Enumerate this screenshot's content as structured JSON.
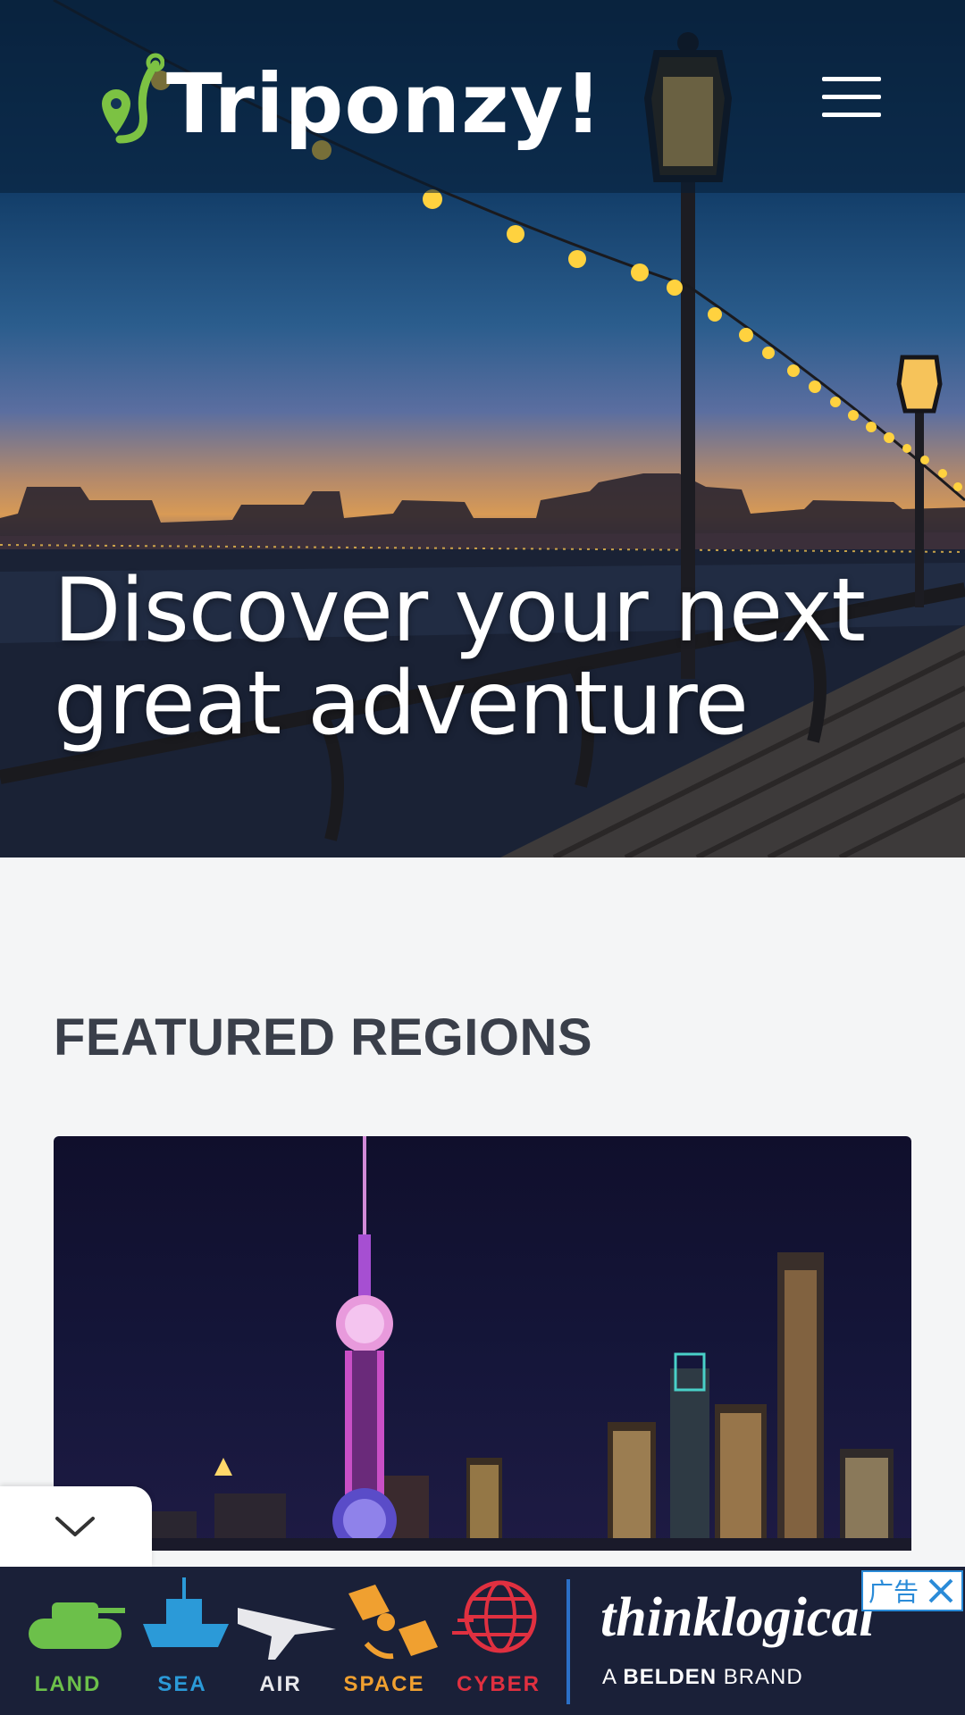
{
  "header": {
    "logo_text": "Triponzy!",
    "logo_icon": "map-pin-route-icon",
    "menu_icon": "hamburger-menu-icon"
  },
  "hero": {
    "title": "Discover your next great adventure"
  },
  "featured": {
    "section_title": "FEATURED REGIONS",
    "card_image": "city-skyline-night-image"
  },
  "collapse": {
    "icon": "chevron-down-icon"
  },
  "ad": {
    "categories": [
      {
        "label": "LAND",
        "icon": "tank-icon",
        "color": "#6cc04a"
      },
      {
        "label": "SEA",
        "icon": "ship-icon",
        "color": "#2b9ad8"
      },
      {
        "label": "AIR",
        "icon": "jet-icon",
        "color": "#e8e8ec"
      },
      {
        "label": "SPACE",
        "icon": "satellite-icon",
        "color": "#f0a030"
      },
      {
        "label": "CYBER",
        "icon": "globe-network-icon",
        "color": "#e03040"
      }
    ],
    "brand": "thinklogical",
    "sub_prefix": "A ",
    "sub_bold": "BELDEN",
    "sub_suffix": " BRAND",
    "badge_text": "广告",
    "close_icon": "close-icon"
  },
  "colors": {
    "logo_green": "#7cc243",
    "section_title": "#3a3f4a",
    "page_bg": "#f4f5f6",
    "ad_bg": "#1a2038",
    "ad_badge": "#2a8bd8"
  }
}
